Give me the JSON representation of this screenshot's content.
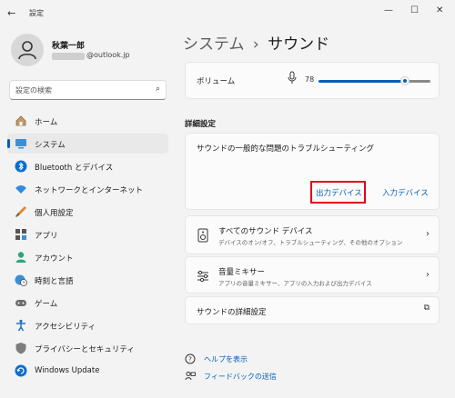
{
  "window": {
    "title": "設定",
    "back_glyph": "←",
    "minimize_glyph": "—",
    "maximize_glyph": "☐",
    "close_glyph": "✕"
  },
  "user": {
    "name": "秋葉一郎",
    "email_suffix": "@outlook.jp"
  },
  "search": {
    "placeholder": "設定の検索",
    "icon": "search-icon",
    "glyph": "⌕"
  },
  "sidebar": {
    "items": [
      {
        "label": "ホーム",
        "icon": "home-icon",
        "selected": false
      },
      {
        "label": "システム",
        "icon": "system-icon",
        "selected": true
      },
      {
        "label": "Bluetooth とデバイス",
        "icon": "bluetooth-icon",
        "selected": false
      },
      {
        "label": "ネットワークとインターネット",
        "icon": "wifi-icon",
        "selected": false
      },
      {
        "label": "個人用設定",
        "icon": "brush-icon",
        "selected": false
      },
      {
        "label": "アプリ",
        "icon": "apps-icon",
        "selected": false
      },
      {
        "label": "アカウント",
        "icon": "account-icon",
        "selected": false
      },
      {
        "label": "時刻と言語",
        "icon": "globe-clock-icon",
        "selected": false
      },
      {
        "label": "ゲーム",
        "icon": "gamepad-icon",
        "selected": false
      },
      {
        "label": "アクセシビリティ",
        "icon": "accessibility-icon",
        "selected": false
      },
      {
        "label": "プライバシーとセキュリティ",
        "icon": "shield-icon",
        "selected": false
      },
      {
        "label": "Windows Update",
        "icon": "update-icon",
        "selected": false
      }
    ]
  },
  "breadcrumb": {
    "parent": "システム",
    "separator": "›",
    "current": "サウンド"
  },
  "volume": {
    "label": "ボリューム",
    "value": "78",
    "level": 0.78
  },
  "advanced": {
    "heading": "詳細設定",
    "troubleshoot_title": "サウンドの一般的な問題のトラブルシューティング",
    "output_button": "出力デバイス",
    "input_button": "入力デバイス"
  },
  "rows": {
    "all_devices_title": "すべてのサウンド デバイス",
    "all_devices_sub": "デバイスのオン/オフ、トラブルシューティング、その他のオプション",
    "mixer_title": "音量ミキサー",
    "mixer_sub": "アプリの音量ミキサー、アプリの入力および出力デバイス",
    "more_settings": "サウンドの詳細設定",
    "chevron": "›",
    "external": "⧉"
  },
  "help": {
    "help_link": "ヘルプを表示",
    "feedback_link": "フィードバックの送信"
  },
  "colors": {
    "accent": "#005fb8",
    "highlight": "#e4001b"
  }
}
